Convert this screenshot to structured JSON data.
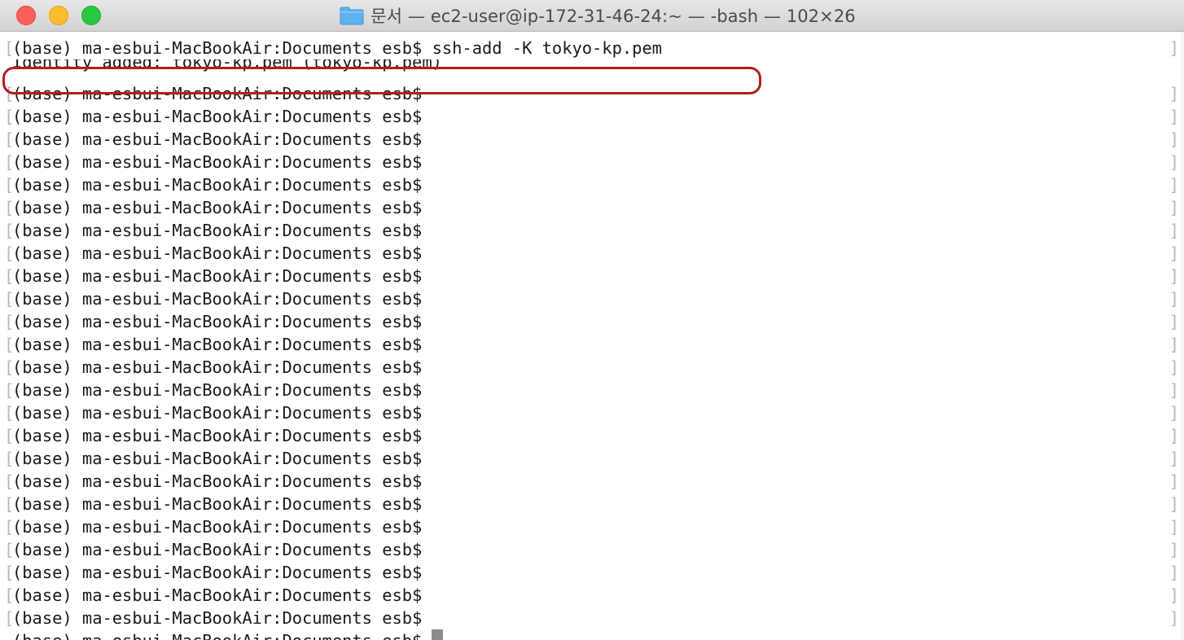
{
  "window": {
    "title": "문서 — ec2-user@ip-172-31-46-24:~ — -bash — 102×26",
    "folder_icon": "folder-icon",
    "controls": {
      "close": "close-icon",
      "minimize": "minimize-icon",
      "zoom": "zoom-icon"
    }
  },
  "terminal": {
    "command_line": "(base) ma-esbui-MacBookAir:Documents esb$ ssh-add -K tokyo-kp.pem",
    "output_line": "Identity added: tokyo-kp.pem (tokyo-kp.pem)",
    "prompt": "(base) ma-esbui-MacBookAir:Documents esb$",
    "prompt_lines": [
      "(base) ma-esbui-MacBookAir:Documents esb$",
      "(base) ma-esbui-MacBookAir:Documents esb$",
      "(base) ma-esbui-MacBookAir:Documents esb$",
      "(base) ma-esbui-MacBookAir:Documents esb$",
      "(base) ma-esbui-MacBookAir:Documents esb$",
      "(base) ma-esbui-MacBookAir:Documents esb$",
      "(base) ma-esbui-MacBookAir:Documents esb$",
      "(base) ma-esbui-MacBookAir:Documents esb$",
      "(base) ma-esbui-MacBookAir:Documents esb$",
      "(base) ma-esbui-MacBookAir:Documents esb$",
      "(base) ma-esbui-MacBookAir:Documents esb$",
      "(base) ma-esbui-MacBookAir:Documents esb$",
      "(base) ma-esbui-MacBookAir:Documents esb$",
      "(base) ma-esbui-MacBookAir:Documents esb$",
      "(base) ma-esbui-MacBookAir:Documents esb$",
      "(base) ma-esbui-MacBookAir:Documents esb$",
      "(base) ma-esbui-MacBookAir:Documents esb$",
      "(base) ma-esbui-MacBookAir:Documents esb$",
      "(base) ma-esbui-MacBookAir:Documents esb$",
      "(base) ma-esbui-MacBookAir:Documents esb$",
      "(base) ma-esbui-MacBookAir:Documents esb$",
      "(base) ma-esbui-MacBookAir:Documents esb$",
      "(base) ma-esbui-MacBookAir:Documents esb$",
      "(base) ma-esbui-MacBookAir:Documents esb$"
    ],
    "highlight_color": "#b21f1a"
  }
}
